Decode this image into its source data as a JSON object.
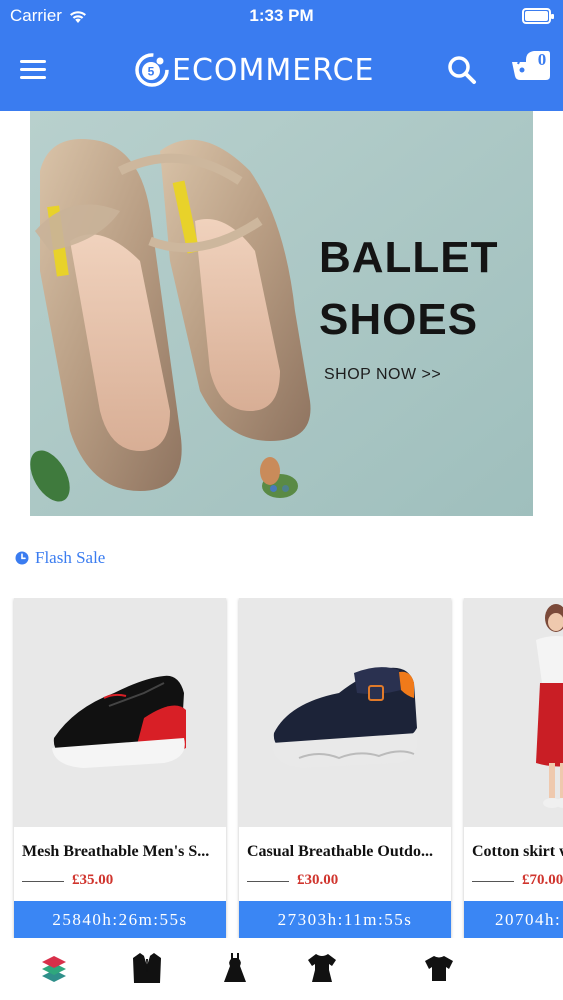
{
  "status_bar": {
    "carrier": "Carrier",
    "time": "1:33 PM"
  },
  "header": {
    "logo_text": "ECOMMERCE",
    "logo_badge": "5",
    "cart_count": "0",
    "icons": [
      "menu-icon",
      "search-icon",
      "cart-icon"
    ]
  },
  "banner": {
    "headline_line1": "BALLET",
    "headline_line2": "SHOES",
    "cta": "SHOP NOW >>",
    "slides": 2,
    "active_slide": 1
  },
  "flash_sale": {
    "title": "Flash Sale",
    "products": [
      {
        "name": "Mesh Breathable Men's S...",
        "price": "£35.00",
        "timer": "25840h:26m:55s"
      },
      {
        "name": "Casual Breathable Outdo...",
        "price": "£30.00",
        "timer": "27303h:11m:55s"
      },
      {
        "name": "Cotton skirt w",
        "price": "£70.00",
        "timer": "20704h:"
      }
    ]
  },
  "bottom_categories": [
    "layers-icon",
    "suit-icon",
    "dress-icon",
    "tshirt-icon",
    "shirt-icon"
  ],
  "colors": {
    "primary": "#3a7cf0",
    "price": "#d0352e",
    "timer_bg": "#3a86f4"
  }
}
